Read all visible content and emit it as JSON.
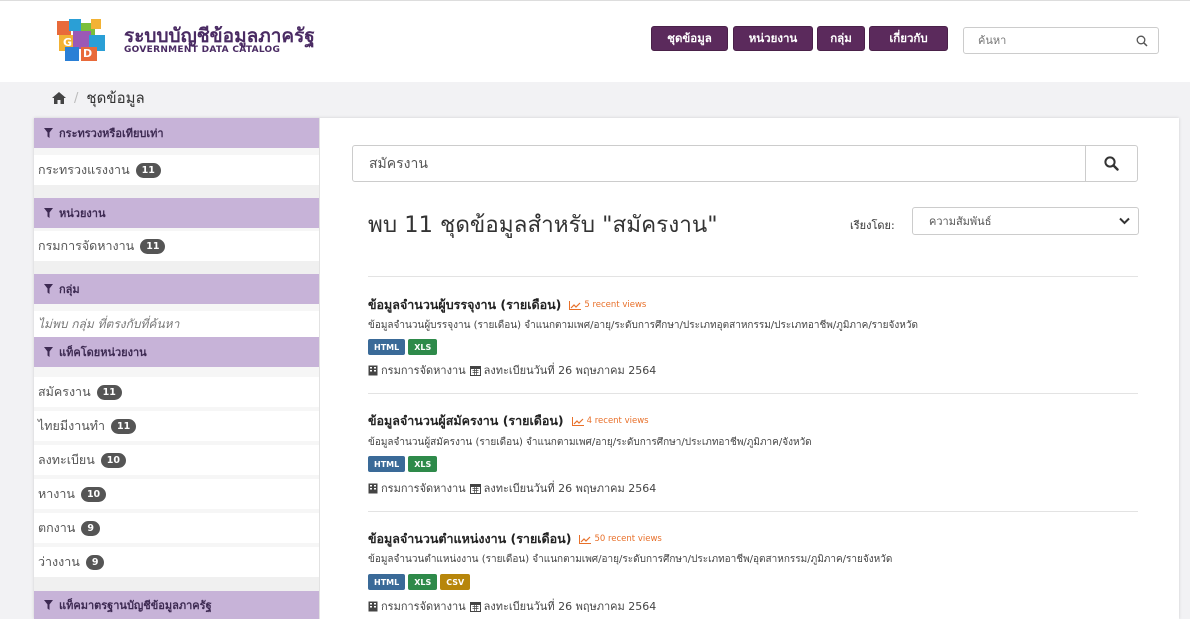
{
  "header": {
    "brand_title": "ระบบบัญชีข้อมูลภาครัฐ",
    "brand_subtitle": "GOVERNMENT DATA CATALOG",
    "nav": [
      "ชุดข้อมูล",
      "หน่วยงาน",
      "กลุ่ม",
      "เกี่ยวกับ"
    ],
    "search_placeholder": "ค้นหา",
    "colors": {
      "nav_bg": "#5b2a5c",
      "brand": "#4a2b63",
      "facet_head": "#c7b3d8"
    }
  },
  "breadcrumb": {
    "home_icon": "home-icon",
    "current": "ชุดข้อมูล"
  },
  "sidebar": {
    "facets": [
      {
        "title": "กระทรวงหรือเทียบเท่า",
        "items": [
          {
            "label": "กระทรวงแรงงาน",
            "count": "11"
          }
        ]
      },
      {
        "title": "หน่วยงาน",
        "items": [
          {
            "label": "กรมการจัดหางาน",
            "count": "11"
          }
        ]
      },
      {
        "title": "กลุ่ม",
        "empty_text": "ไม่พบ กลุ่ม ที่ตรงกับที่ค้นหา"
      },
      {
        "title": "แท็คโดยหน่วยงาน",
        "items": [
          {
            "label": "สมัครงาน",
            "count": "11"
          },
          {
            "label": "ไทยมีงานทำ",
            "count": "11"
          },
          {
            "label": "ลงทะเบียน",
            "count": "10"
          },
          {
            "label": "หางาน",
            "count": "10"
          },
          {
            "label": "ตกงาน",
            "count": "9"
          },
          {
            "label": "ว่างงาน",
            "count": "9"
          }
        ]
      },
      {
        "title": "แท็คมาตรฐานบัญชีข้อมูลภาครัฐ"
      }
    ]
  },
  "main": {
    "search_value": "สมัครงาน",
    "results_title": "พบ 11 ชุดข้อมูลสำหรับ \"สมัครงาน\"",
    "sort_label": "เรียงโดย:",
    "sort_value": "ความสัมพันธ์",
    "datasets": [
      {
        "title": "ข้อมูลจำนวนผู้บรรจุงาน (รายเดือน)",
        "views": "5 recent views",
        "description": "ข้อมูลจำนวนผู้บรรจุงาน (รายเดือน) จำแนกตามเพศ/อายุ/ระดับการศึกษา/ประเภทอุตสาหกรรม/ประเภทอาชีพ/ภูมิภาค/รายจังหวัด",
        "formats": [
          "HTML",
          "XLS"
        ],
        "org": "กรมการจัดหางาน",
        "date": "ลงทะเบียนวันที่ 26 พฤษภาคม 2564"
      },
      {
        "title": "ข้อมูลจำนวนผู้สมัครงาน (รายเดือน)",
        "views": "4 recent views",
        "description": "ข้อมูลจำนวนผู้สมัครงาน (รายเดือน) จำแนกตามเพศ/อายุ/ระดับการศึกษา/ประเภทอาชีพ/ภูมิภาค/จังหวัด",
        "formats": [
          "HTML",
          "XLS"
        ],
        "org": "กรมการจัดหางาน",
        "date": "ลงทะเบียนวันที่ 26 พฤษภาคม 2564"
      },
      {
        "title": "ข้อมูลจำนวนตำแหน่งงาน (รายเดือน)",
        "views": "50 recent views",
        "description": "ข้อมูลจำนวนตำแหน่งงาน (รายเดือน) จำแนกตามเพศ/อายุ/ระดับการศึกษา/ประเภทอาชีพ/อุตสาหกรรม/ภูมิภาค/รายจังหวัด",
        "formats": [
          "HTML",
          "XLS",
          "CSV"
        ],
        "org": "กรมการจัดหางาน",
        "date": "ลงทะเบียนวันที่ 26 พฤษภาคม 2564"
      }
    ]
  }
}
